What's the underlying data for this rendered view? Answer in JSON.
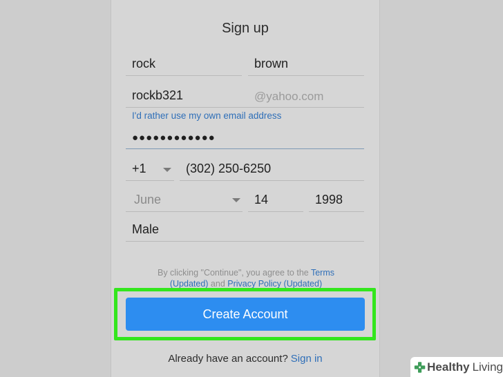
{
  "form": {
    "title": "Sign up",
    "first_name": "rock",
    "last_name": "brown",
    "username": "rockb321",
    "email_suffix": "@yahoo.com",
    "own_email_link": "I'd rather use my own email address",
    "password_mask": "●●●●●●●●●●●●",
    "country_code": "+1",
    "phone": "(302) 250-6250",
    "birth_month": "June",
    "birth_day": "14",
    "birth_year": "1998",
    "gender": "Male"
  },
  "terms": {
    "prefix": "By clicking \"Continue\", you agree to the ",
    "terms_link": "Terms (Updated)",
    "and": " and ",
    "privacy_link": "Privacy Policy (Updated)"
  },
  "actions": {
    "create_account": "Create Account",
    "already_text": "Already have an account?",
    "sign_in": "Sign in"
  },
  "watermark": {
    "word1": "Healthy",
    "word2": "Living"
  },
  "colors": {
    "primary_button": "#2d8df0",
    "highlight": "#33e61d",
    "link": "#2f6fb8"
  }
}
